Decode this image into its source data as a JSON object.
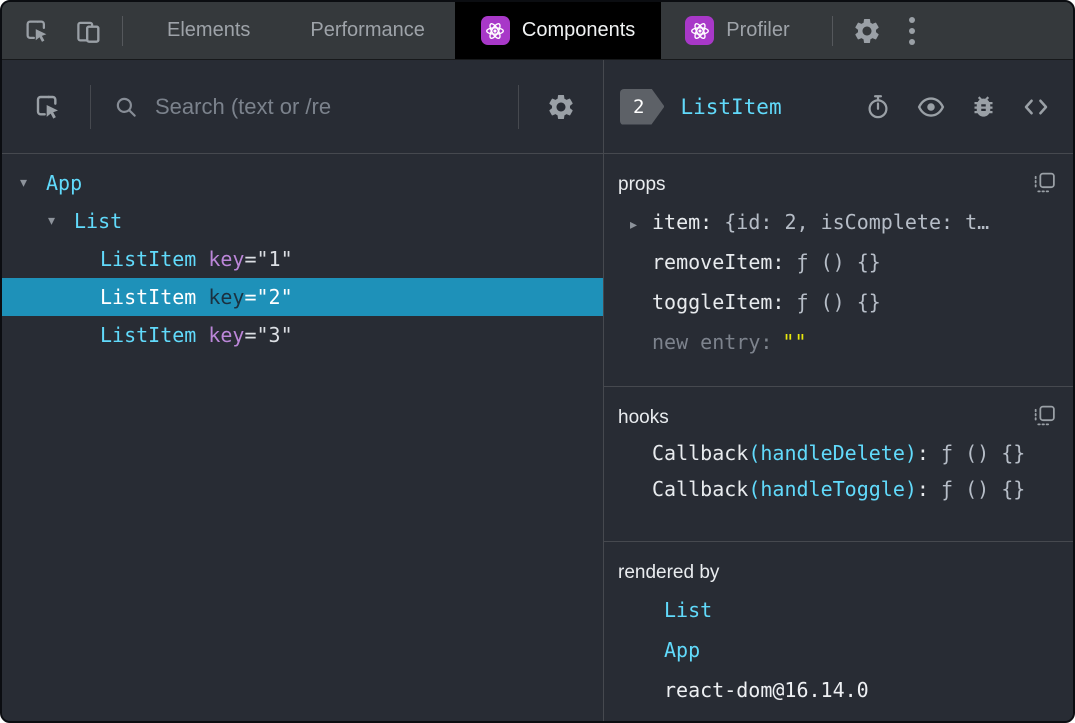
{
  "tabbar": {
    "tabs": [
      {
        "label": "Elements"
      },
      {
        "label": "Performance"
      },
      {
        "label": "Components"
      },
      {
        "label": "Profiler"
      }
    ]
  },
  "left_toolbar": {
    "search_placeholder": "Search (text or /re"
  },
  "tree": {
    "rows": [
      {
        "label": "App"
      },
      {
        "label": "List"
      },
      {
        "label": "ListItem",
        "attr": "key",
        "value": "=\"1\""
      },
      {
        "label": "ListItem",
        "attr": "key",
        "value": "=\"2\""
      },
      {
        "label": "ListItem",
        "attr": "key",
        "value": "=\"3\""
      }
    ]
  },
  "inspector": {
    "badge": "2",
    "component": "ListItem",
    "props": {
      "title": "props",
      "rows": [
        {
          "name": "item",
          "colon": ":",
          "value": "{id: 2, isComplete: t…"
        },
        {
          "name": "removeItem",
          "colon": ":",
          "value": "ƒ () {}"
        },
        {
          "name": "toggleItem",
          "colon": ":",
          "value": "ƒ () {}"
        },
        {
          "name": "new entry",
          "colon": ":",
          "value": "\"\""
        }
      ]
    },
    "hooks": {
      "title": "hooks",
      "rows": [
        {
          "name": "Callback",
          "fn": "(handleDelete)",
          "colon": ":",
          "value": "ƒ () {}"
        },
        {
          "name": "Callback",
          "fn": "(handleToggle)",
          "colon": ":",
          "value": "ƒ () {}"
        }
      ]
    },
    "rendered_by": {
      "title": "rendered by",
      "rows": [
        {
          "label": "List"
        },
        {
          "label": "App"
        },
        {
          "label": "react-dom@16.14.0"
        }
      ]
    }
  },
  "icons": {
    "expanded": "▾",
    "collapsed": "▸"
  },
  "colors": {
    "accent_cyan": "#61dafb",
    "accent_purple": "#bb86d8",
    "selection_blue": "#1e91b9",
    "react_badge_purple": "#a838c8",
    "editable_yellow": "#e9e90c",
    "panel_background": "#282c34",
    "toolbar_background": "#35393c",
    "active_tab_background": "#000000"
  }
}
